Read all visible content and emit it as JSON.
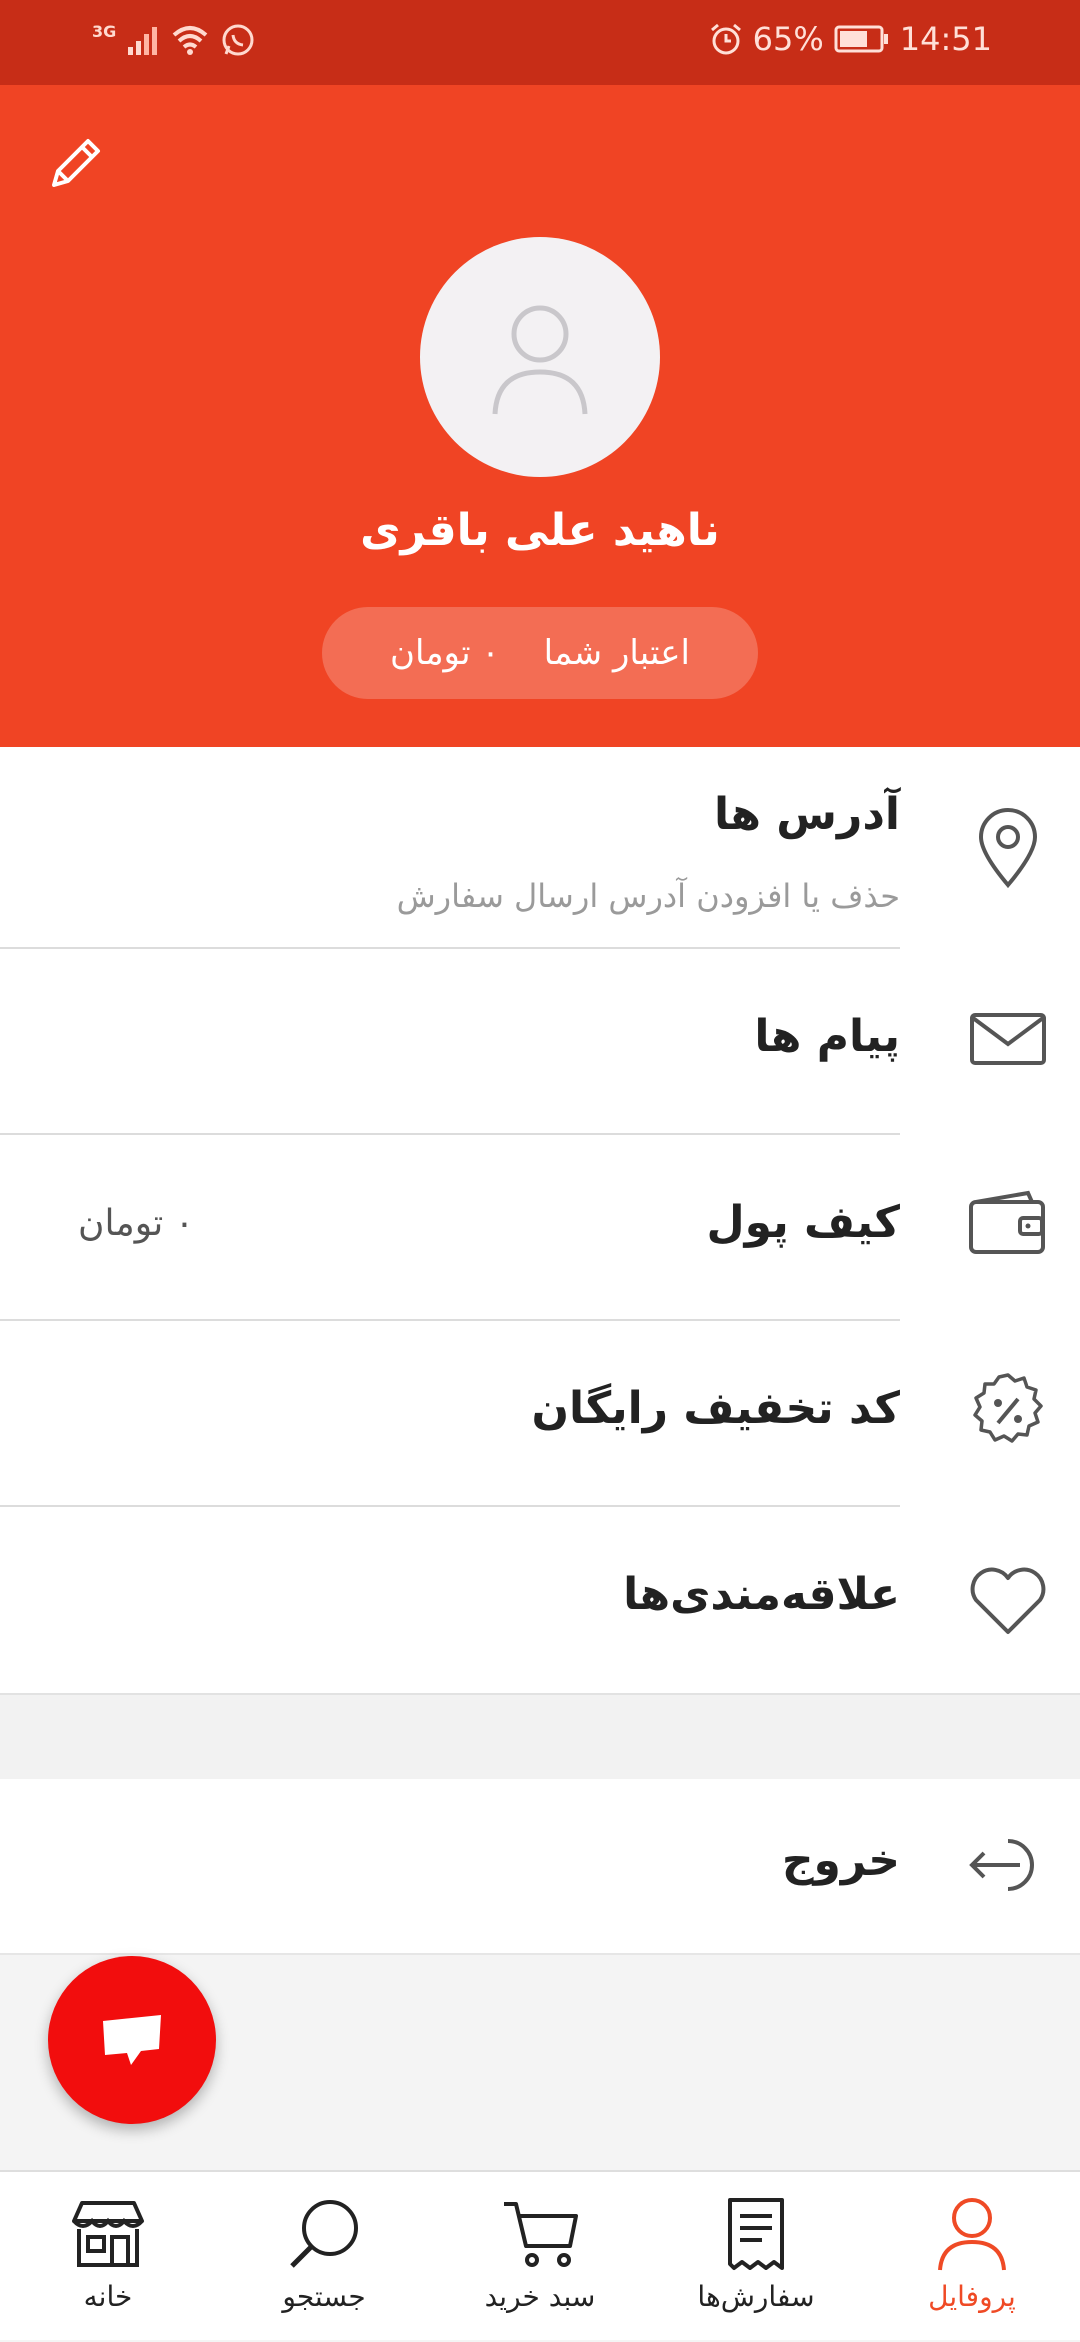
{
  "status_bar": {
    "network": "3G",
    "battery": "65%",
    "time": "14:51"
  },
  "header": {
    "user_name": "ناهید علی باقری",
    "credit_label": "اعتبار شما",
    "credit_value": "۰ تومان",
    "edit_icon": "pencil-icon",
    "avatar_icon": "user-icon"
  },
  "menu": {
    "addresses": {
      "label": "آدرس ها",
      "subtitle": "حذف یا افزودن آدرس ارسال سفارش",
      "icon": "location-pin-icon"
    },
    "messages": {
      "label": "پیام ها",
      "icon": "envelope-icon"
    },
    "wallet": {
      "label": "کیف پول",
      "value": "۰ تومان",
      "icon": "wallet-icon"
    },
    "discount": {
      "label": "کد تخفیف رایگان",
      "icon": "discount-badge-icon"
    },
    "favorites": {
      "label": "علاقه‌مندی‌ها",
      "icon": "heart-icon"
    }
  },
  "logout": {
    "label": "خروج",
    "icon": "logout-icon"
  },
  "fab": {
    "icon": "chat-icon"
  },
  "bottom_nav": [
    {
      "label": "خانه",
      "icon": "store-icon"
    },
    {
      "label": "جستجو",
      "icon": "search-icon"
    },
    {
      "label": "سبد خرید",
      "icon": "cart-icon"
    },
    {
      "label": "سفارش‌ها",
      "icon": "receipt-icon"
    },
    {
      "label": "پروفایل",
      "icon": "profile-icon",
      "active": true
    }
  ],
  "colors": {
    "brand": "#f04424",
    "status_bar": "#c72d17",
    "fab": "#f20d0d",
    "active_nav": "#ef4a25"
  }
}
